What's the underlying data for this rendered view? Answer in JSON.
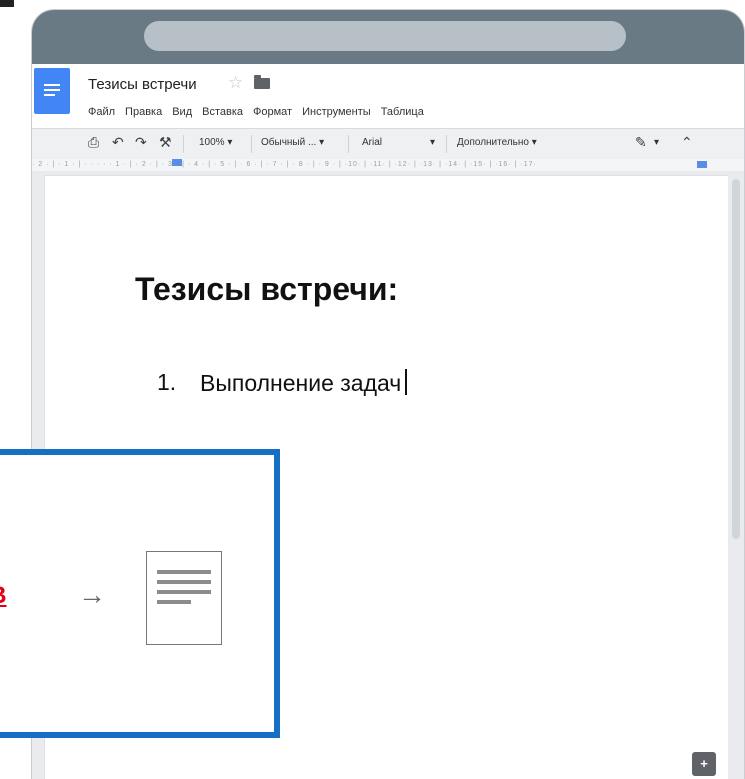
{
  "browser": {
    "address_bar_value": ""
  },
  "document": {
    "title": "Тезисы встречи",
    "menu": [
      "Файл",
      "Правка",
      "Вид",
      "Вставка",
      "Формат",
      "Инструменты",
      "Таблица"
    ]
  },
  "toolbar": {
    "zoom": "100%",
    "style": "Обычный ...",
    "font": "Arial",
    "more": "Дополнительно",
    "print_icon": "print-icon",
    "undo_icon": "undo-icon",
    "redo_icon": "redo-icon",
    "paint_format_icon": "paint-format-icon",
    "pen_icon": "pen-icon",
    "collapse_icon": "collapse-icon"
  },
  "ruler": {
    "text": "· 2 · | · 1 · | · · · · · 1 · | · 2 · | · 3 · | · 4 · | · 5 · | · 6 · | · 7 · | · 8 · | · 9 · | ·10· | ·11· | ·12· | ·13· | ·14· | ·15· | ·16· | ·17·"
  },
  "content": {
    "heading": "Тезисы встречи:",
    "list_items": [
      {
        "number": "1.",
        "text": "Выполнение задач"
      }
    ]
  },
  "overlay": {
    "text": "БВ",
    "arrow": "→",
    "accent_color": "#1570c5",
    "text_color": "#e3001b"
  },
  "explore_icon": "explore-icon"
}
